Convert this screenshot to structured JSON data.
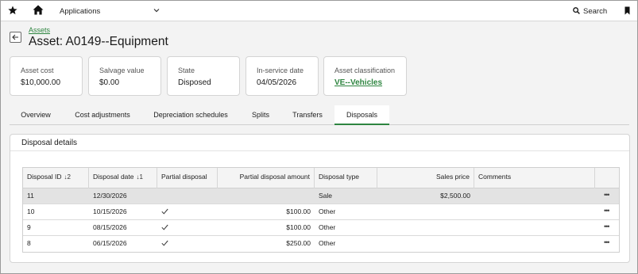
{
  "topbar": {
    "applications_label": "Applications",
    "search_label": "Search"
  },
  "breadcrumb": {
    "parent": "Assets"
  },
  "page": {
    "title": "Asset: A0149--Equipment"
  },
  "summary_cards": [
    {
      "label": "Asset cost",
      "value": "$10,000.00"
    },
    {
      "label": "Salvage value",
      "value": "$0.00"
    },
    {
      "label": "State",
      "value": "Disposed"
    },
    {
      "label": "In-service date",
      "value": "04/05/2026"
    },
    {
      "label": "Asset classification",
      "value": "VE--Vehicles"
    }
  ],
  "tabs": [
    {
      "label": "Overview"
    },
    {
      "label": "Cost adjustments"
    },
    {
      "label": "Depreciation schedules"
    },
    {
      "label": "Splits"
    },
    {
      "label": "Transfers"
    },
    {
      "label": "Disposals",
      "active": true
    }
  ],
  "panel": {
    "title": "Disposal details"
  },
  "table": {
    "columns": [
      {
        "label": "Disposal ID",
        "sort": "↓2"
      },
      {
        "label": "Disposal date",
        "sort": "↓1"
      },
      {
        "label": "Partial disposal"
      },
      {
        "label": "Partial disposal amount"
      },
      {
        "label": "Disposal type"
      },
      {
        "label": "Sales price"
      },
      {
        "label": "Comments"
      }
    ],
    "rows": [
      {
        "id": "11",
        "date": "12/30/2026",
        "partial": false,
        "amount": "",
        "type": "Sale",
        "price": "$2,500.00",
        "comments": "",
        "selected": true
      },
      {
        "id": "10",
        "date": "10/15/2026",
        "partial": true,
        "amount": "$100.00",
        "type": "Other",
        "price": "",
        "comments": ""
      },
      {
        "id": "9",
        "date": "08/15/2026",
        "partial": true,
        "amount": "$100.00",
        "type": "Other",
        "price": "",
        "comments": ""
      },
      {
        "id": "8",
        "date": "06/15/2026",
        "partial": true,
        "amount": "$250.00",
        "type": "Other",
        "price": "",
        "comments": ""
      }
    ],
    "row_menu_label": "•••"
  },
  "colors": {
    "accent": "#2e8540",
    "selected_row": "#e3e3e3"
  },
  "icons": [
    "star-icon",
    "home-icon",
    "chevron-down-icon",
    "search-icon",
    "bookmark-icon",
    "back-arrow-icon",
    "checkmark-icon",
    "more-options-icon"
  ]
}
